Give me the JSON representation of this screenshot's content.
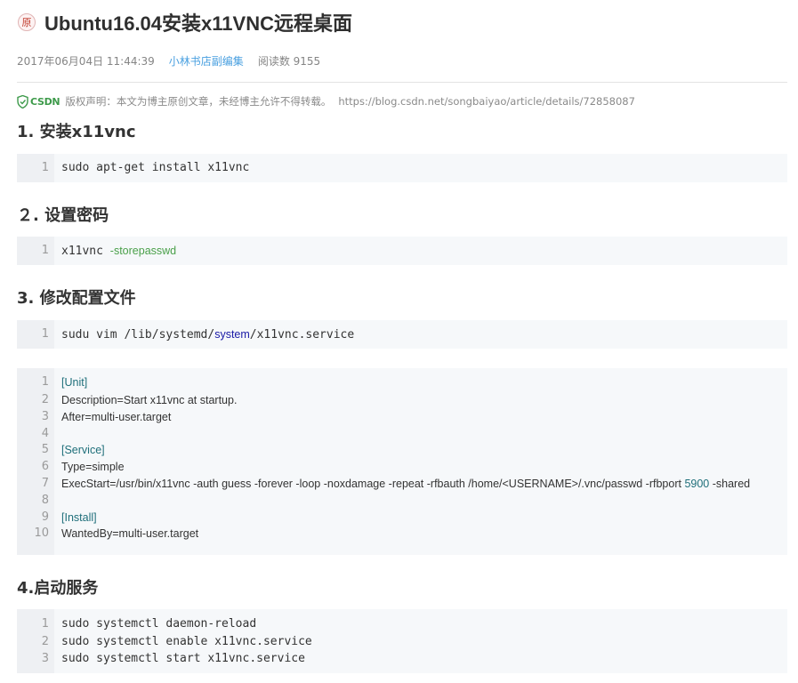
{
  "title": {
    "badge": "原",
    "text": "Ubuntu16.04安装x11VNC远程桌面"
  },
  "meta": {
    "date": "2017年06月04日 11:44:39",
    "author": "小林书店副编集",
    "reads": "阅读数 9155"
  },
  "copyright": {
    "logo_text": "CSDN",
    "text": "版权声明：本文为博主原创文章，未经博主允许不得转载。",
    "url": "https://blog.csdn.net/songbaiyao/article/details/72858087"
  },
  "sections": {
    "s1": "1. 安装x11vnc",
    "s2": "２. 设置密码",
    "s3": "3. 修改配置文件",
    "s4": "4.启动服务"
  },
  "code1": {
    "lines": [
      {
        "n": "1",
        "text": "sudo apt-get install x11vnc"
      }
    ]
  },
  "code2": {
    "lines": [
      {
        "n": "1",
        "a": "x11vnc ",
        "b": "-storepasswd"
      }
    ]
  },
  "code3": {
    "lines": [
      {
        "n": "1",
        "a": "sudu vim /lib/systemd/",
        "b": "system",
        "c": "/x11vnc.service"
      }
    ]
  },
  "code4": {
    "lines": [
      {
        "n": "1",
        "text": "[Unit]"
      },
      {
        "n": "2",
        "text": "Description=Start x11vnc at startup."
      },
      {
        "n": "3",
        "text": "After=multi-user.target"
      },
      {
        "n": "4",
        "text": ""
      },
      {
        "n": "5",
        "text": "[Service]"
      },
      {
        "n": "6",
        "text": "Type=simple"
      },
      {
        "n": "7",
        "a": "ExecStart=/usr/bin/x11vnc -auth guess -forever -loop -noxdamage -repeat -rfbauth /home/<USERNAME>/.vnc/passwd -rfbport ",
        "b": "5900",
        "c": " -shared"
      },
      {
        "n": "8",
        "text": ""
      },
      {
        "n": "9",
        "text": "[Install]"
      },
      {
        "n": "10",
        "text": "WantedBy=multi-user.target"
      }
    ]
  },
  "code5": {
    "lines": [
      {
        "n": "1",
        "text": "sudo systemctl daemon-reload"
      },
      {
        "n": "2",
        "text": "sudo systemctl enable x11vnc.service"
      },
      {
        "n": "3",
        "text": "sudo systemctl start x11vnc.service"
      }
    ]
  },
  "colors": {
    "link": "#4aa0e0",
    "option": "#4aa04a",
    "keyword": "#1a1aa6",
    "section": "#1f6f7a"
  }
}
